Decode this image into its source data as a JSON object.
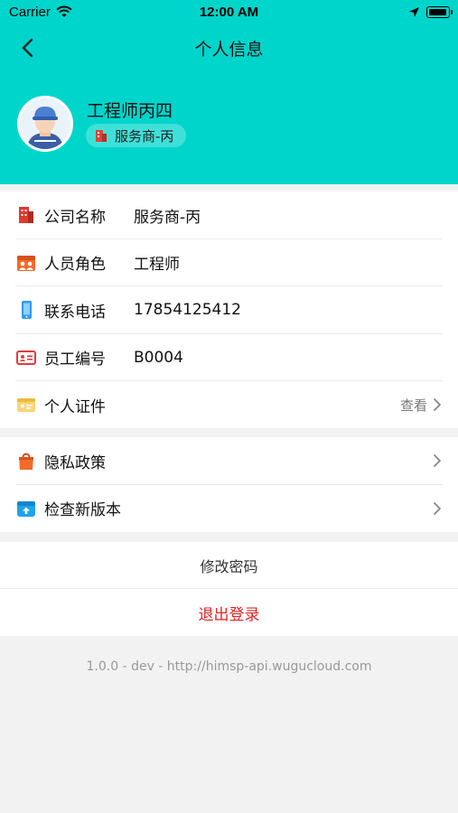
{
  "status_bar": {
    "carrier": "Carrier",
    "time": "12:00 AM"
  },
  "nav": {
    "title": "个人信息",
    "back_icon": "chevron-left-icon"
  },
  "profile": {
    "name": "工程师丙四",
    "company": "服务商-丙",
    "avatar_icon": "engineer-avatar"
  },
  "info_rows": [
    {
      "icon": "building-icon",
      "label": "公司名称",
      "value": "服务商-丙"
    },
    {
      "icon": "team-icon",
      "label": "人员角色",
      "value": "工程师"
    },
    {
      "icon": "phone-icon",
      "label": "联系电话",
      "value": "17854125412"
    },
    {
      "icon": "id-card-icon",
      "label": "员工编号",
      "value": "B0004"
    },
    {
      "icon": "certificate-icon",
      "label": "个人证件",
      "value": "",
      "action": "查看"
    }
  ],
  "settings_rows": [
    {
      "icon": "privacy-bag-icon",
      "label": "隐私政策"
    },
    {
      "icon": "update-icon",
      "label": "检查新版本"
    }
  ],
  "actions": {
    "change_password": "修改密码",
    "logout": "退出登录"
  },
  "version": "1.0.0 - dev - http://himsp-api.wugucloud.com",
  "colors": {
    "header": "#00d5cc",
    "logout": "#e62222",
    "background": "#f2f2f2"
  }
}
